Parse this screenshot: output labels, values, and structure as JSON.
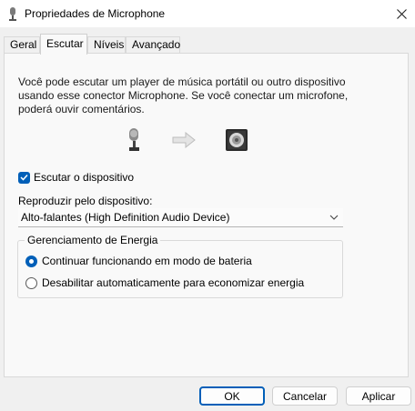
{
  "window": {
    "title": "Propriedades de Microphone",
    "title_icon": "microphone-icon",
    "close_icon": "close-icon"
  },
  "tabs": [
    {
      "label": "Geral",
      "active": false
    },
    {
      "label": "Escutar",
      "active": true
    },
    {
      "label": "Níveis",
      "active": false
    },
    {
      "label": "Avançado",
      "active": false
    }
  ],
  "listen": {
    "description": "Você pode escutar um player de música portátil ou outro dispositivo usando esse conector Microphone. Se você conectar um microfone, poderá ouvir comentários.",
    "icons": [
      "microphone-icon",
      "arrow-right-icon",
      "speaker-icon"
    ],
    "checkbox_label": "Escutar o dispositivo",
    "checkbox_checked": true,
    "playback_label": "Reproduzir pelo dispositivo:",
    "playback_device": "Alto-falantes (High Definition Audio Device)"
  },
  "power": {
    "group_title": "Gerenciamento de Energia",
    "options": [
      {
        "label": "Continuar funcionando em modo de bateria",
        "selected": true
      },
      {
        "label": "Desabilitar automaticamente para economizar energia",
        "selected": false
      }
    ]
  },
  "buttons": {
    "ok": "OK",
    "cancel": "Cancelar",
    "apply": "Aplicar"
  },
  "colors": {
    "accent": "#005fb8",
    "panel": "#f9f9f9",
    "window": "#f0f0f0"
  }
}
